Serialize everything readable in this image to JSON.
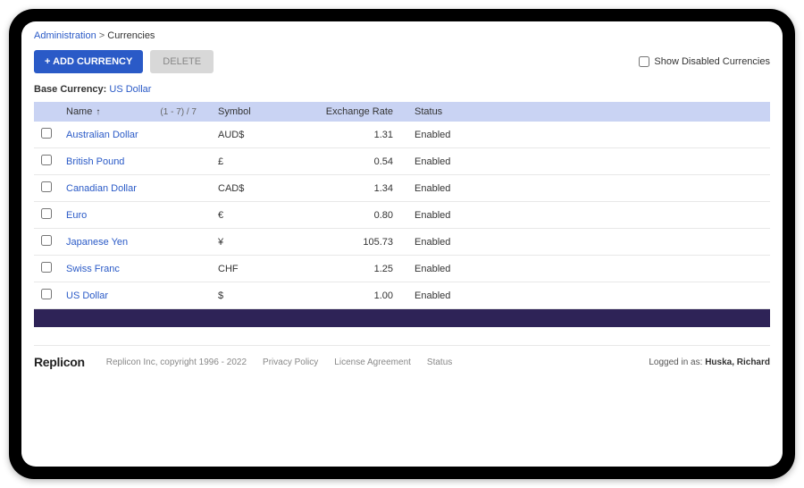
{
  "breadcrumb": {
    "root": "Administration",
    "current": "Currencies"
  },
  "toolbar": {
    "add_label": "+ ADD CURRENCY",
    "delete_label": "DELETE",
    "show_disabled_label": "Show Disabled Currencies"
  },
  "base_currency": {
    "label": "Base Currency:",
    "value": "US Dollar"
  },
  "table": {
    "headers": {
      "name": "Name",
      "page_info": "(1 - 7) / 7",
      "symbol": "Symbol",
      "rate": "Exchange Rate",
      "status": "Status"
    },
    "rows": [
      {
        "name": "Australian Dollar",
        "symbol": "AUD$",
        "rate": "1.31",
        "status": "Enabled"
      },
      {
        "name": "British Pound",
        "symbol": "£",
        "rate": "0.54",
        "status": "Enabled"
      },
      {
        "name": "Canadian Dollar",
        "symbol": "CAD$",
        "rate": "1.34",
        "status": "Enabled"
      },
      {
        "name": "Euro",
        "symbol": "€",
        "rate": "0.80",
        "status": "Enabled"
      },
      {
        "name": "Japanese Yen",
        "symbol": "¥",
        "rate": "105.73",
        "status": "Enabled"
      },
      {
        "name": "Swiss Franc",
        "symbol": "CHF",
        "rate": "1.25",
        "status": "Enabled"
      },
      {
        "name": "US Dollar",
        "symbol": "$",
        "rate": "1.00",
        "status": "Enabled"
      }
    ]
  },
  "footer": {
    "logo": "Replicon",
    "copyright": "Replicon Inc, copyright 1996 - 2022",
    "privacy": "Privacy Policy",
    "license": "License Agreement",
    "status": "Status",
    "logged_in_label": "Logged in as:",
    "user": "Huska, Richard"
  }
}
